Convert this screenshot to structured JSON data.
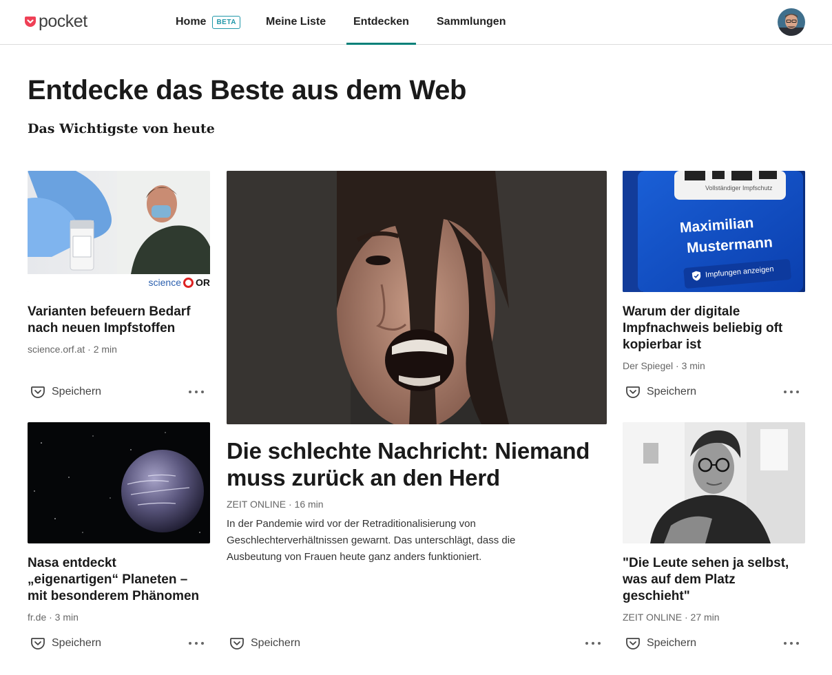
{
  "brand": {
    "name": "pocket",
    "accent": "#ef4056"
  },
  "nav": {
    "home": "Home",
    "home_badge": "BETA",
    "my_list": "Meine Liste",
    "discover": "Entdecken",
    "collections": "Sammlungen",
    "active": "Entdecken",
    "active_color": "#008078"
  },
  "page": {
    "title": "Entdecke das Beste aus dem Web",
    "section": "Das Wichtigste von heute"
  },
  "save_label": "Speichern",
  "articles": [
    {
      "title": "Varianten befeuern Bedarf nach neuen Impfstoffen",
      "meta": "science.orf.at · 2 min",
      "image_watermark": "science",
      "image_watermark_logo": "OR",
      "image": "vaccine-vial-photo"
    },
    {
      "title": "Die schlechte Nachricht: Niemand muss zurück an den Herd",
      "meta": "ZEIT ONLINE · 16 min",
      "excerpt": "In der Pandemie wird vor der Retraditionalisierung von Geschlechterverhältnissen gewarnt. Das unterschlägt, dass die Ausbeutung von Frauen heute ganz anders funktioniert.",
      "image": "screaming-woman-photo"
    },
    {
      "title": "Warum der digitale Impfnachweis beliebig oft kopierbar ist",
      "meta": "Der Spiegel · 3 min",
      "image": "vaccination-certificate-app-photo",
      "image_text": {
        "top": "Vollständiger Impfschutz",
        "name_first": "Maximilian",
        "name_last": "Mustermann",
        "button": "Impfungen anzeigen"
      }
    },
    {
      "title": "Nasa entdeckt „eigenartigen“ Planeten – mit besonderem Phänomen",
      "meta": "fr.de · 3 min",
      "image": "planet-in-space-photo"
    },
    {
      "title": "\"Die Leute sehen ja selbst, was auf dem Platz geschieht\"",
      "meta": "ZEIT ONLINE · 27 min",
      "image": "man-with-glasses-bw-photo"
    }
  ]
}
